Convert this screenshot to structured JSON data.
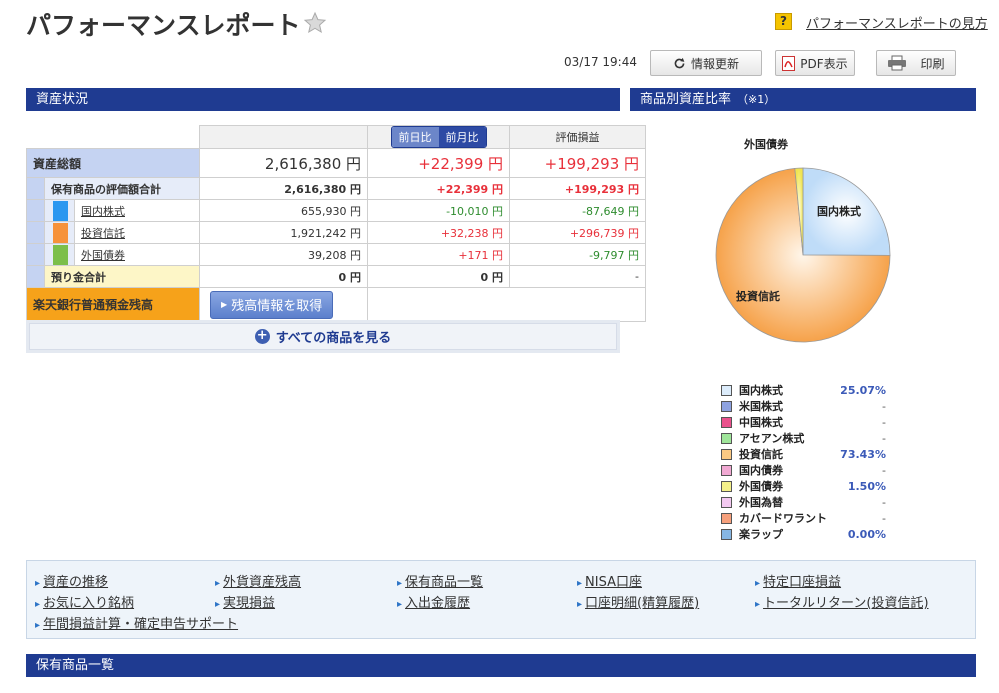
{
  "header": {
    "title": "パフォーマンスレポート",
    "help_link": "パフォーマンスレポートの見方",
    "help_icon_glyph": "?",
    "timestamp": "03/17 19:44",
    "refresh_label": "情報更新",
    "pdf_label": "PDF表示",
    "print_label": "印刷"
  },
  "asset_section": {
    "title": "資産状況",
    "col_day": "前日比",
    "col_month": "前月比",
    "col_eval": "評価損益",
    "total": {
      "label": "資産総額",
      "value": "2,616,380 円",
      "change": "+22,399 円",
      "eval": "+199,293 円"
    },
    "holdings_total": {
      "label": "保有商品の評価額合計",
      "value": "2,616,380 円",
      "change": "+22,399 円",
      "eval": "+199,293 円"
    },
    "rows": [
      {
        "label": "国内株式",
        "value": "655,930 円",
        "change": "-10,010 円",
        "eval": "-87,649 円",
        "color": "#2b97f0"
      },
      {
        "label": "投資信託",
        "value": "1,921,242 円",
        "change": "+32,238 円",
        "eval": "+296,739 円",
        "color": "#f6923a"
      },
      {
        "label": "外国債券",
        "value": "39,208 円",
        "change": "+171 円",
        "eval": "-9,797 円",
        "color": "#7cbf4a"
      }
    ],
    "deposit": {
      "label": "預り金合計",
      "value": "0 円",
      "change": "0 円",
      "eval": "-"
    },
    "bank": {
      "label": "楽天銀行普通預金残高",
      "button": "残高情報を取得"
    },
    "see_all": "すべての商品を見る"
  },
  "ratio_section": {
    "title": "商品別資産比率",
    "note": "（※1）",
    "pie_labels": {
      "domestic": "国内株式",
      "fund": "投資信託",
      "foreign_bond": "外国債券"
    },
    "legend": [
      {
        "name": "国内株式",
        "value": "25.07%",
        "color": "#dcecfb"
      },
      {
        "name": "米国株式",
        "value": "-",
        "color": "#8ea2e0"
      },
      {
        "name": "中国株式",
        "value": "-",
        "color": "#e9518c"
      },
      {
        "name": "アセアン株式",
        "value": "-",
        "color": "#9fe59a"
      },
      {
        "name": "投資信託",
        "value": "73.43%",
        "color": "#fbc983"
      },
      {
        "name": "国内債券",
        "value": "-",
        "color": "#f1a9d3"
      },
      {
        "name": "外国債券",
        "value": "1.50%",
        "color": "#f4f08a"
      },
      {
        "name": "外国為替",
        "value": "-",
        "color": "#f3c9f1"
      },
      {
        "name": "カバードワラント",
        "value": "-",
        "color": "#f6a07c"
      },
      {
        "name": "楽ラップ",
        "value": "0.00%",
        "color": "#86b6e3"
      }
    ]
  },
  "chart_data": {
    "type": "pie",
    "categories": [
      "国内株式",
      "投資信託",
      "外国債券"
    ],
    "values": [
      25.07,
      73.43,
      1.5
    ],
    "colors": [
      "#dcecfb",
      "#fbc983",
      "#f4f08a"
    ]
  },
  "links": [
    "資産の推移",
    "外貨資産残高",
    "保有商品一覧",
    "NISA口座",
    "特定口座損益",
    "お気に入り銘柄",
    "実現損益",
    "入出金履歴",
    "口座明細(精算履歴)",
    "トータルリターン(投資信託)",
    "年間損益計算・確定申告サポート"
  ],
  "holdings_section": {
    "title": "保有商品一覧"
  }
}
